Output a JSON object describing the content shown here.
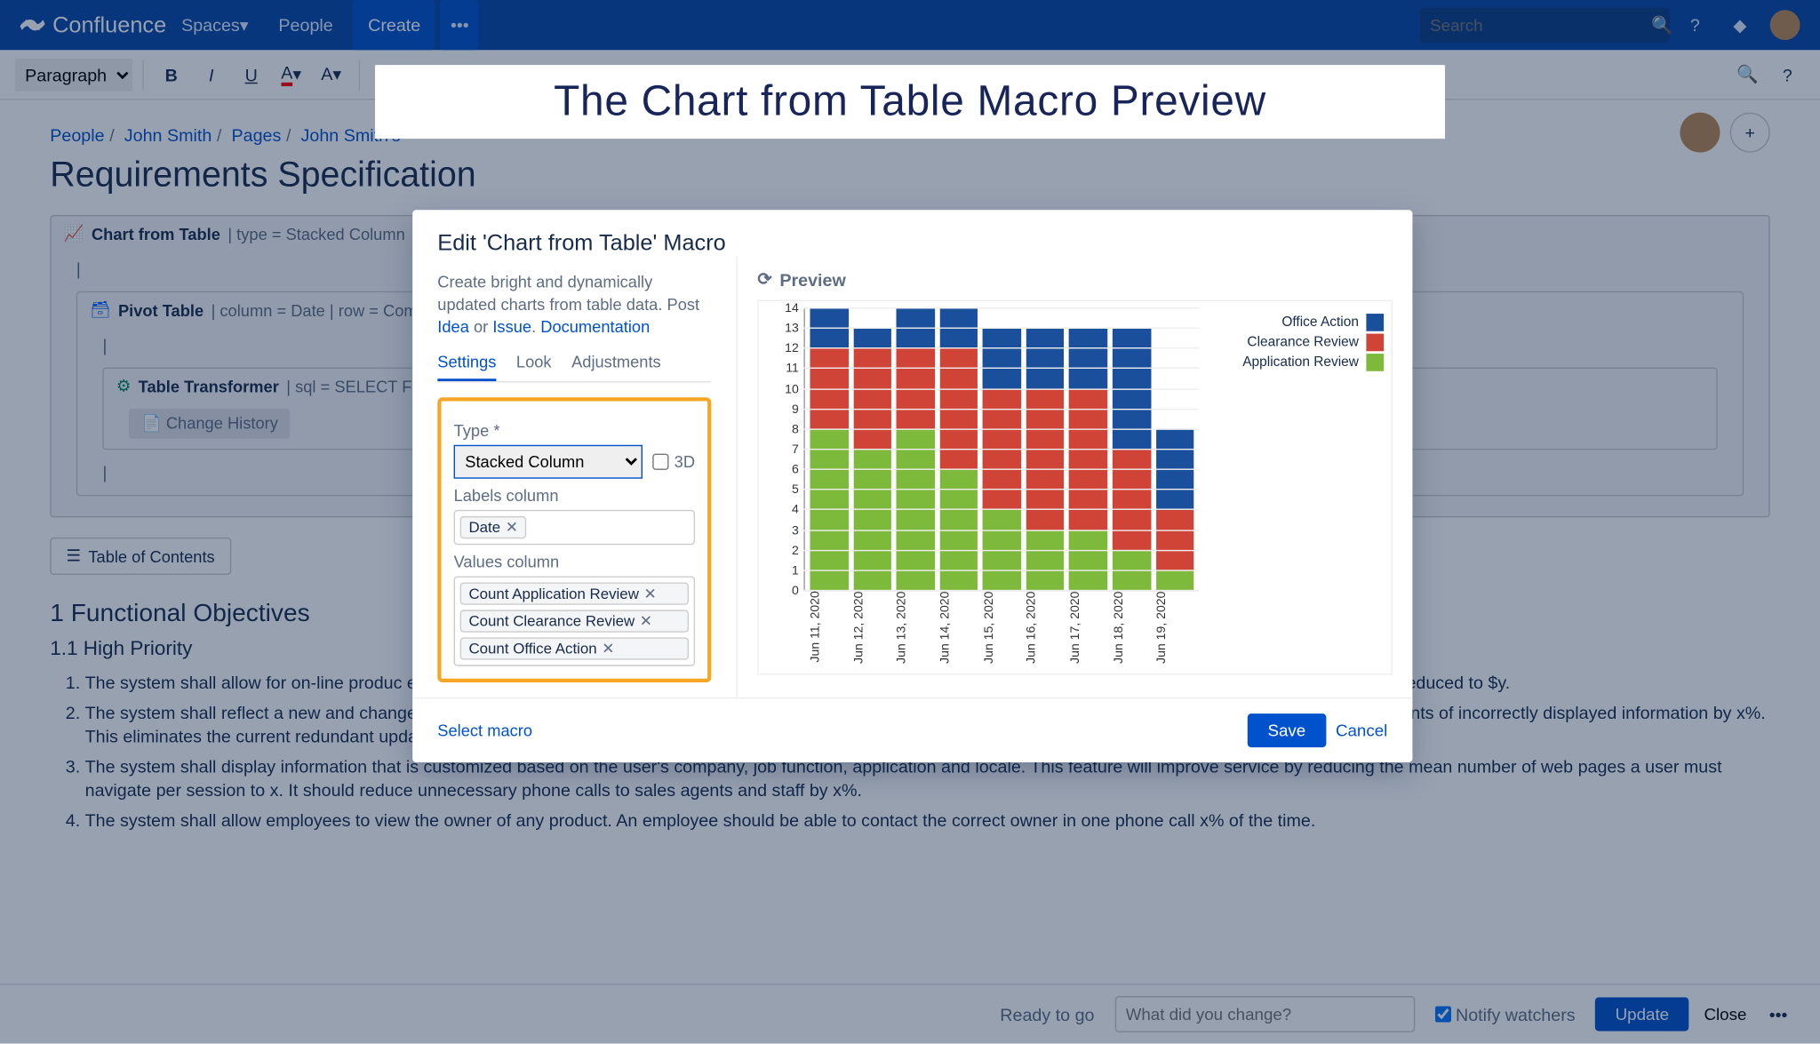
{
  "topnav": {
    "app_name": "Confluence",
    "spaces": "Spaces",
    "people": "People",
    "create": "Create",
    "search_placeholder": "Search"
  },
  "toolbar": {
    "paragraph": "Paragraph"
  },
  "breadcrumbs": {
    "people": "People",
    "john": "John Smith",
    "pages": "Pages",
    "current": "John Smith's"
  },
  "page": {
    "title": "Requirements Specification"
  },
  "macros": {
    "chart_from_table_name": "Chart from Table",
    "chart_from_table_params": "| type = Stacked Column",
    "pivot_table_name": "Pivot Table",
    "pivot_table_params": "| column = Date | row = Com",
    "table_transformer_name": "Table Transformer",
    "table_transformer_params": "| sql = SELECT FOR",
    "change_history": "Change History"
  },
  "toc": "Table of Contents",
  "sections": {
    "s1": "1 Functional Objectives",
    "s11": "1.1 High Priority"
  },
  "requirements": [
    "The system shall allow for on-line produc                                                                                                                                                                                                                                   e placement of the order. This will reduce the time a sales agent spends on an order by x%. The cost to process an order will be reduced to $y.",
    "The system shall reflect a new and changed product description within x minutes of the database being updated by the product owner. This will reduce the number of incidents of incorrectly displayed information by x%. This eliminates the current redundant update of information, saving $y dollars annually.",
    "The system shall display information that is customized based on the user's company, job function, application and locale. This feature will improve service by reducing the mean number of web pages a user must navigate per session to x. It should reduce unnecessary phone calls to sales agents and staff by x%.",
    "The system shall allow employees to view the owner of any product. An employee should be able to contact the correct owner in one phone call x% of the time."
  ],
  "bottombar": {
    "ready": "Ready to go",
    "change_placeholder": "What did you change?",
    "notify": "Notify watchers",
    "update": "Update",
    "close": "Close"
  },
  "overlay_title": "The Chart from Table Macro Preview",
  "modal": {
    "title": "Edit 'Chart from Table' Macro",
    "desc1": "Create bright and dynamically updated charts from table data. Post ",
    "link_idea": "Idea",
    "desc_or": " or ",
    "link_issue": "Issue",
    "desc_dot": ". ",
    "link_doc": "Documentation",
    "tabs": {
      "settings": "Settings",
      "look": "Look",
      "adjustments": "Adjustments"
    },
    "type_label": "Type *",
    "type_value": "Stacked Column",
    "three_d": "3D",
    "labels_column_label": "Labels column",
    "labels_tag": "Date",
    "values_column_label": "Values column",
    "values_tags": [
      "Count Application Review",
      "Count Clearance Review",
      "Count Office Action"
    ],
    "preview": "Preview",
    "select_macro": "Select macro",
    "save": "Save",
    "cancel": "Cancel"
  },
  "chart_data": {
    "type": "bar",
    "stacked": true,
    "categories": [
      "Jun 11, 2020",
      "Jun 12, 2020",
      "Jun 13, 2020",
      "Jun 14, 2020",
      "Jun 15, 2020",
      "Jun 16, 2020",
      "Jun 17, 2020",
      "Jun 18, 2020",
      "Jun 19, 2020"
    ],
    "series": [
      {
        "name": "Application Review",
        "color": "#7db93b",
        "values": [
          8,
          7,
          8,
          6,
          4,
          3,
          3,
          2,
          1
        ]
      },
      {
        "name": "Clearance Review",
        "color": "#d04437",
        "values": [
          4,
          5,
          4,
          6,
          6,
          7,
          7,
          5,
          3
        ]
      },
      {
        "name": "Office Action",
        "color": "#1a4f9c",
        "values": [
          2,
          1,
          2,
          2,
          3,
          3,
          3,
          6,
          4
        ]
      }
    ],
    "legend_order": [
      "Office Action",
      "Clearance Review",
      "Application Review"
    ],
    "ylim": [
      0,
      14
    ],
    "yticks": [
      0,
      1,
      2,
      3,
      4,
      5,
      6,
      7,
      8,
      9,
      10,
      11,
      12,
      13,
      14
    ]
  }
}
